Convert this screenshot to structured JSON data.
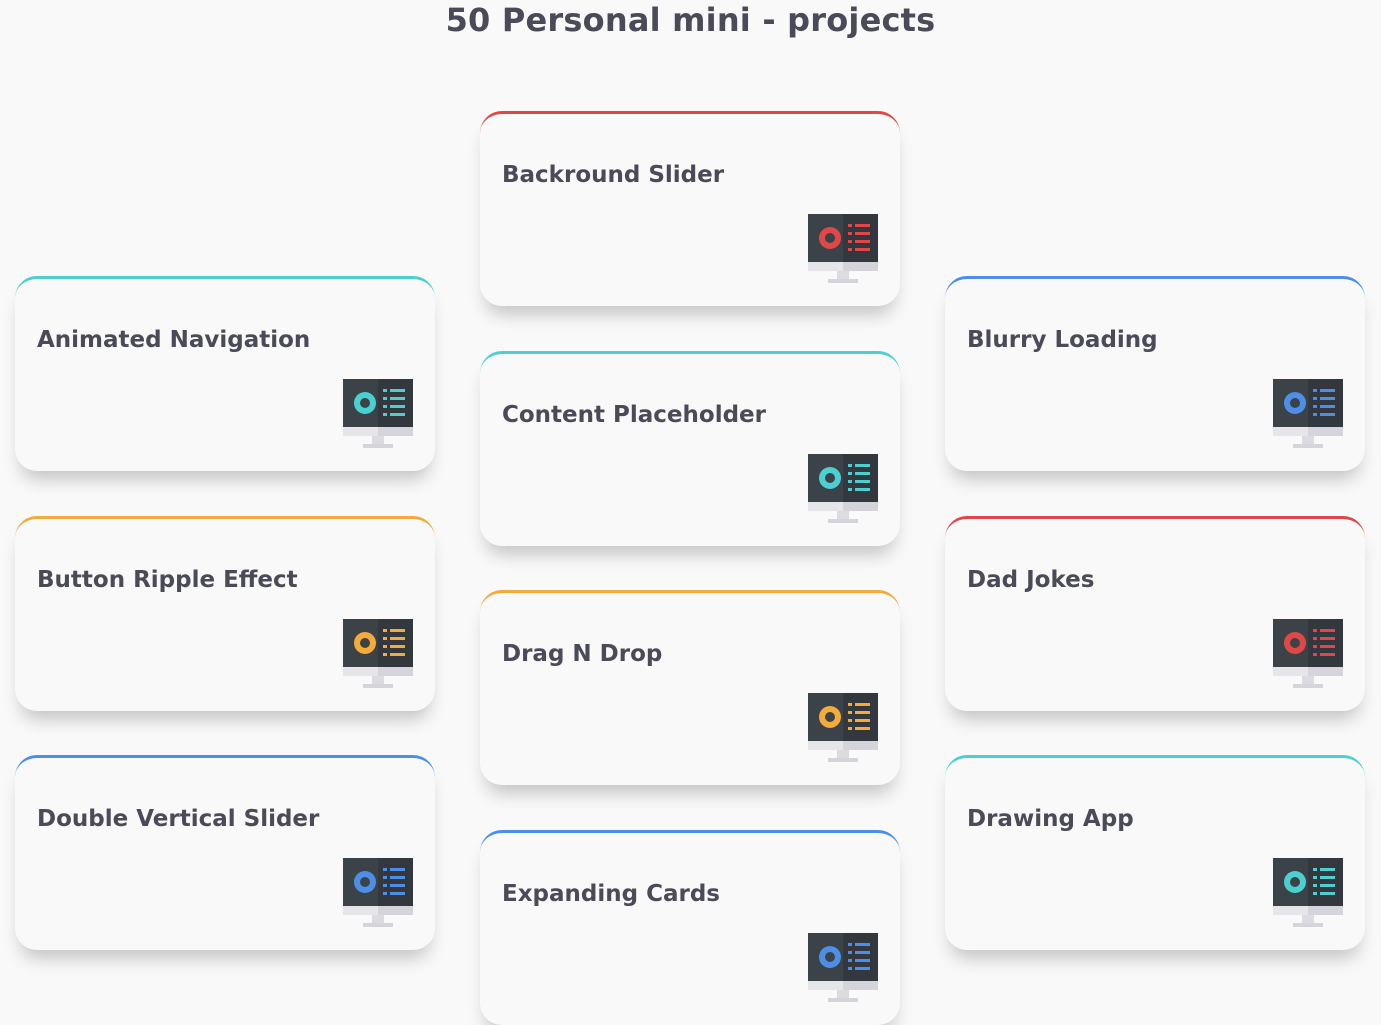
{
  "page": {
    "title": "50 Personal mini - projects"
  },
  "icon_name": "monitor-icon",
  "colors": {
    "red": "#e04848",
    "teal": "#4ccfcf",
    "orange": "#f3ab3c",
    "blue": "#4d8fe6"
  },
  "cards": [
    {
      "title": "Backround Slider",
      "color": "red"
    },
    {
      "title": "Animated Navigation",
      "color": "teal"
    },
    {
      "title": "Blurry Loading",
      "color": "blue"
    },
    {
      "title": "Content Placeholder",
      "color": "teal"
    },
    {
      "title": "Button Ripple Effect",
      "color": "orange"
    },
    {
      "title": "Dad Jokes",
      "color": "red"
    },
    {
      "title": "Drag N Drop",
      "color": "orange"
    },
    {
      "title": "Double Vertical Slider",
      "color": "blue"
    },
    {
      "title": "Drawing App",
      "color": "teal"
    },
    {
      "title": "Expanding Cards",
      "color": "blue"
    }
  ]
}
